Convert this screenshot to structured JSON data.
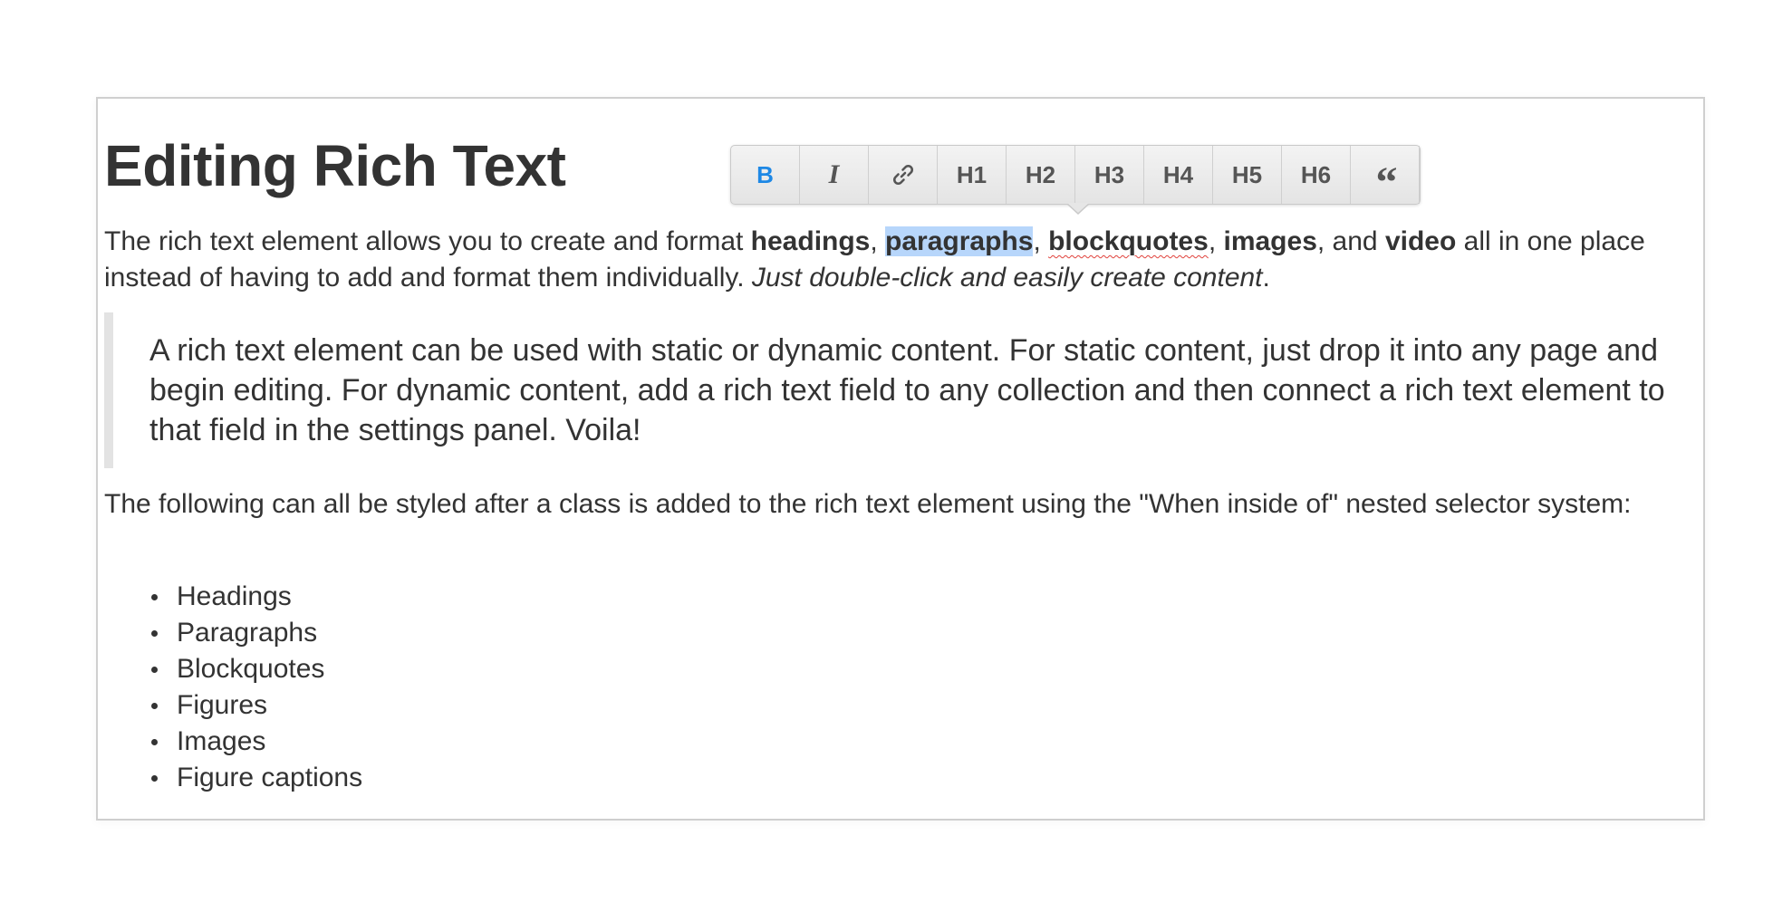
{
  "title": "Editing Rich Text",
  "toolbar": {
    "bold_label": "B",
    "italic_label": "I",
    "link_icon": "link-icon",
    "h1": "H1",
    "h2": "H2",
    "h3": "H3",
    "h4": "H4",
    "h5": "H5",
    "h6": "H6",
    "quote_label": "“",
    "active_color": "#1e88e5"
  },
  "intro": {
    "t1": "The rich text element allows you to create and format ",
    "b_headings": "headings",
    "s1": ", ",
    "b_paragraphs": "paragraphs",
    "s2": ", ",
    "b_blockquotes": "blockquotes",
    "s3": ", ",
    "b_images": "images",
    "s4": ", and ",
    "b_video": "video",
    "t2": " all in one place instead of having to add and format them individually. ",
    "italic": "Just double-click and easily create content",
    "end": "."
  },
  "blockquote": "A rich text element can be used with static or dynamic content. For static content, just drop it into any page and begin editing. For dynamic content, add a rich text field to any collection and then connect a rich text element to that field in the settings panel. Voila!",
  "following": "The following can all be styled after a class is added to the rich text element using the \"When inside of\" nested selector system:",
  "list": [
    "Headings",
    "Paragraphs",
    "Blockquotes",
    "Figures",
    "Images",
    "Figure captions"
  ],
  "colors": {
    "text": "#333333",
    "selection": "#b7d6fb",
    "blockquote_border": "#e3e3e3",
    "spellcheck": "#e0413b"
  }
}
